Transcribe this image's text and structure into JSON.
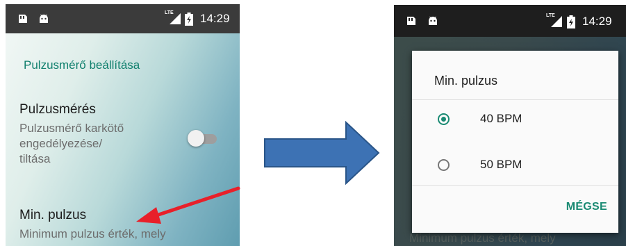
{
  "left_screen": {
    "statusbar": {
      "time": "14:29",
      "network": "LTE",
      "icons": [
        "sim-card-icon",
        "android-icon",
        "signal-icon",
        "battery-charging-icon"
      ]
    },
    "section_title": "Pulzusmérő beállítása",
    "prefs": [
      {
        "title": "Pulzusmérés",
        "summary_lines": [
          "Pulzusmérő karkötő",
          "engedélyezése/",
          "tiltása"
        ],
        "toggle_on": false
      },
      {
        "title": "Min. pulzus",
        "summary_lines": [
          "Minimum pulzus érték, mely"
        ]
      }
    ]
  },
  "right_screen": {
    "statusbar": {
      "time": "14:29",
      "network": "LTE"
    },
    "dialog": {
      "title": "Min. pulzus",
      "options": [
        {
          "label": "40 BPM",
          "selected": true
        },
        {
          "label": "50 BPM",
          "selected": false
        }
      ],
      "cancel_label": "MÉGSE"
    },
    "background_text": "Minimum pulzus érték, mely"
  },
  "colors": {
    "accent_teal": "#11806e",
    "dialog_accent": "#1a8a73",
    "red_arrow": "#e8202a",
    "blue_arrow": "#3d72b4"
  }
}
